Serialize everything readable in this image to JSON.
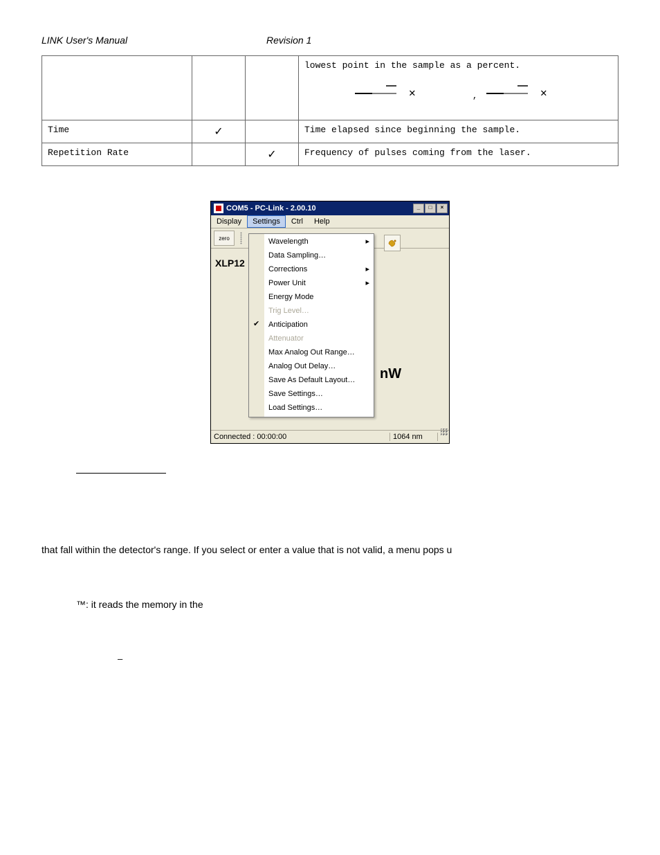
{
  "header": {
    "left": "LINK  User's Manual",
    "mid": "Revision  1"
  },
  "table": {
    "row0": {
      "desc": "lowest point in the sample as a percent."
    },
    "row1": {
      "label": "Time",
      "check1": "✓",
      "check2": "",
      "desc": "Time elapsed since beginning the sample."
    },
    "row2": {
      "label": "Repetition Rate",
      "check1": "",
      "check2": "✓",
      "desc": "Frequency of pulses coming from the laser."
    }
  },
  "app": {
    "title": "COM5 - PC-Link - 2.00.10",
    "menus": {
      "display": "Display",
      "settings": "Settings",
      "ctrl": "Ctrl",
      "help": "Help"
    },
    "toolbar": {
      "zero": "zero"
    },
    "bg": {
      "xlp": "XLP12",
      "nw": "nW"
    },
    "dropdown": {
      "wavelength": "Wavelength",
      "data_sampling": "Data Sampling…",
      "corrections": "Corrections",
      "power_unit": "Power Unit",
      "energy_mode": "Energy Mode",
      "trig_level": "Trig Level…",
      "anticipation": "Anticipation",
      "attenuator": "Attenuator",
      "max_analog": "Max Analog Out Range…",
      "analog_delay": "Analog Out Delay…",
      "save_default": "Save As Default Layout…",
      "save_settings": "Save Settings…",
      "load_settings": "Load Settings…"
    },
    "status": {
      "left": "Connected : 00:00:00",
      "right": "1064 nm"
    }
  },
  "body": {
    "para1": "that fall within the detector's range.  If you select or enter a value that is not valid, a menu pops u",
    "para2": "™: it reads the memory in the",
    "hyphen": "–"
  }
}
